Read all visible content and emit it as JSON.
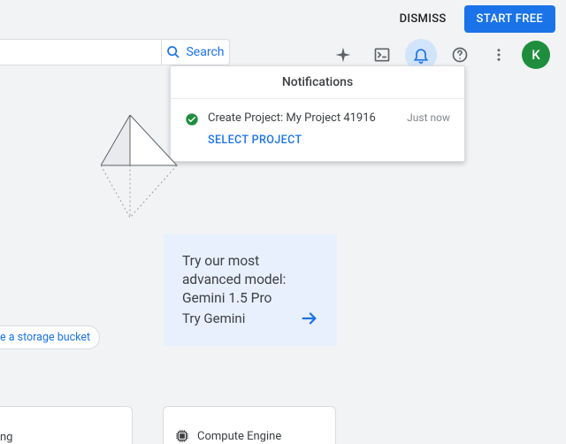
{
  "topBar": {
    "dismiss": "DISMISS",
    "startFree": "START FREE"
  },
  "search": {
    "label": "Search"
  },
  "avatar": {
    "initial": "K"
  },
  "notifications": {
    "header": "Notifications",
    "item": {
      "title": "Create Project: My Project 41916",
      "time": "Just now",
      "action": "SELECT PROJECT"
    }
  },
  "gemini": {
    "title": "Try our most advanced model: Gemini 1.5 Pro",
    "cta": "Try Gemini"
  },
  "linkPill": "e a storage bucket",
  "bottom": {
    "card1Trail": "ng",
    "card2": "Compute Engine"
  }
}
